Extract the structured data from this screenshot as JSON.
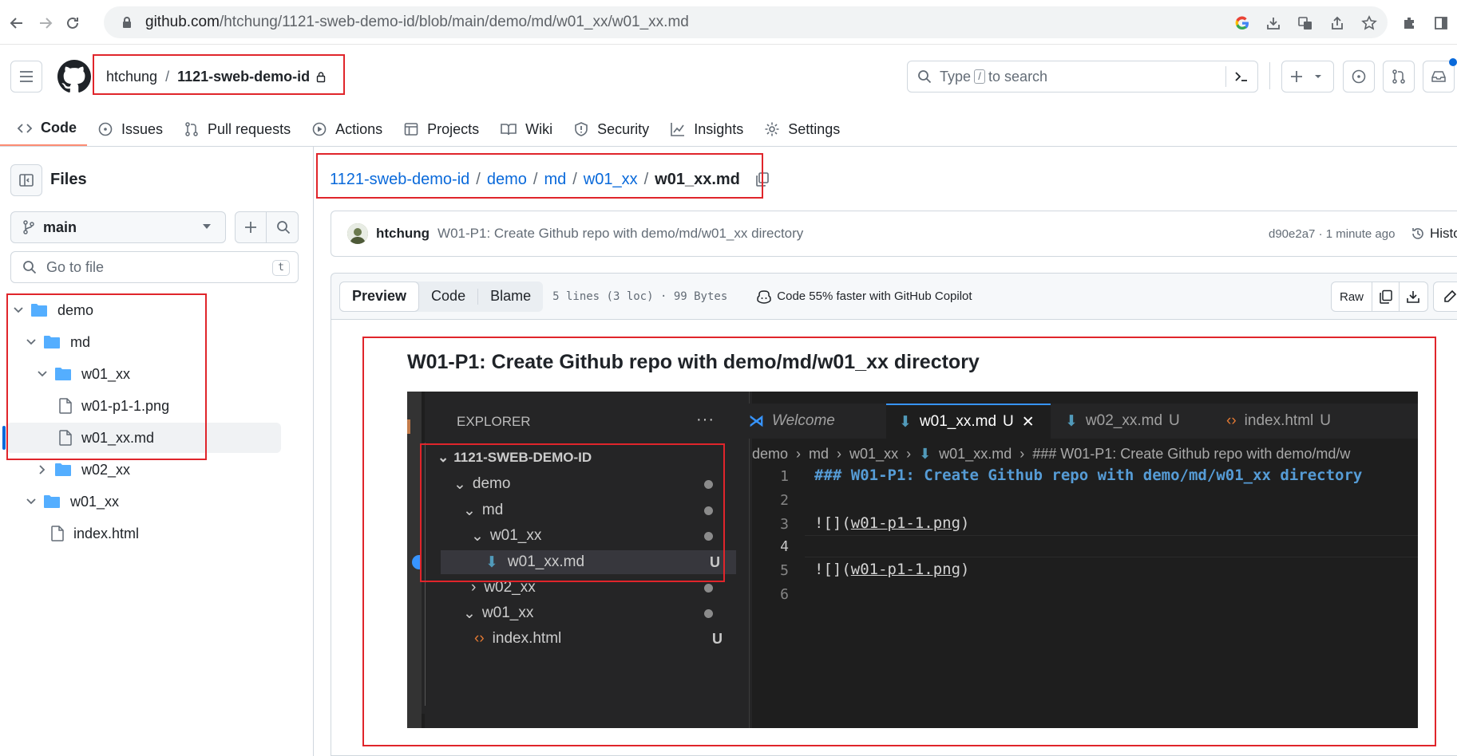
{
  "browser": {
    "url_host": "github.com",
    "url_path": "/htchung/1121-sweb-demo-id/blob/main/demo/md/w01_xx/w01_xx.md"
  },
  "header": {
    "owner": "htchung",
    "separator": "/",
    "repo": "1121-sweb-demo-id",
    "search_pre": "Type",
    "search_key": "/",
    "search_post": "to search"
  },
  "tabs": [
    {
      "label": "Code",
      "icon": "code-icon"
    },
    {
      "label": "Issues",
      "icon": "issue-icon"
    },
    {
      "label": "Pull requests",
      "icon": "pull-request-icon"
    },
    {
      "label": "Actions",
      "icon": "play-icon"
    },
    {
      "label": "Projects",
      "icon": "table-icon"
    },
    {
      "label": "Wiki",
      "icon": "book-icon"
    },
    {
      "label": "Security",
      "icon": "shield-icon"
    },
    {
      "label": "Insights",
      "icon": "graph-icon"
    },
    {
      "label": "Settings",
      "icon": "gear-icon"
    }
  ],
  "sidebar": {
    "title": "Files",
    "branch": "main",
    "goto_placeholder": "Go to file",
    "goto_key": "t",
    "tree": [
      {
        "label": "demo",
        "type": "folder",
        "expanded": true
      },
      {
        "label": "md",
        "type": "folder",
        "expanded": true
      },
      {
        "label": "w01_xx",
        "type": "folder",
        "expanded": true
      },
      {
        "label": "w01-p1-1.png",
        "type": "file"
      },
      {
        "label": "w01_xx.md",
        "type": "file",
        "selected": true
      },
      {
        "label": "w02_xx",
        "type": "folder",
        "expanded": false
      },
      {
        "label": "w01_xx",
        "type": "folder",
        "expanded": true
      },
      {
        "label": "index.html",
        "type": "file"
      }
    ]
  },
  "breadcrumb": {
    "repo": "1121-sweb-demo-id",
    "p1": "demo",
    "p2": "md",
    "p3": "w01_xx",
    "file": "w01_xx.md",
    "sep": "/"
  },
  "commit": {
    "author": "htchung",
    "message": "W01-P1: Create Github repo with demo/md/w01_xx directory",
    "meta": "d90e2a7 · 1 minute ago",
    "history_label": "Histo"
  },
  "filebar": {
    "preview": "Preview",
    "code": "Code",
    "blame": "Blame",
    "info": "5 lines (3 loc) · 99 Bytes",
    "copilot": "Code 55% faster with GitHub Copilot",
    "raw": "Raw"
  },
  "markdown": {
    "heading": "W01-P1: Create Github repo with demo/md/w01_xx directory"
  },
  "vscode": {
    "explorer_title": "EXPLORER",
    "explorer_more": "···",
    "tabs": [
      {
        "label": "Welcome"
      },
      {
        "label": "w01_xx.md",
        "badge": "U",
        "active": true
      },
      {
        "label": "w02_xx.md",
        "badge": "U"
      },
      {
        "label": "index.html",
        "badge": "U"
      }
    ],
    "tree": [
      {
        "label": "1121-SWEB-DEMO-ID"
      },
      {
        "label": "demo"
      },
      {
        "label": "md"
      },
      {
        "label": "w01_xx"
      },
      {
        "label": "w01_xx.md",
        "badge": "U"
      },
      {
        "label": "w02_xx"
      },
      {
        "label": "w01_xx"
      },
      {
        "label": "index.html",
        "badge": "U"
      }
    ],
    "crumb": [
      "demo",
      "md",
      "w01_xx",
      "w01_xx.md",
      "### W01-P1: Create Github repo with demo/md/w"
    ],
    "lines": [
      {
        "n": "1",
        "text": "### W01-P1: Create Github repo with demo/md/w01_xx directory"
      },
      {
        "n": "2",
        "text": ""
      },
      {
        "n": "3",
        "pre": "![](",
        "link": "w01-p1-1.png",
        "post": ")"
      },
      {
        "n": "4",
        "text": ""
      },
      {
        "n": "5",
        "pre": "![](",
        "link": "w01-p1-1.png",
        "post": ")"
      },
      {
        "n": "6",
        "text": ""
      }
    ]
  },
  "colors": {
    "accent": "#0969da",
    "highlight_box": "#e0252b",
    "tab_underline": "#fd8c73",
    "folder": "#54aeff",
    "vscode_bg": "#1e1e1e"
  }
}
